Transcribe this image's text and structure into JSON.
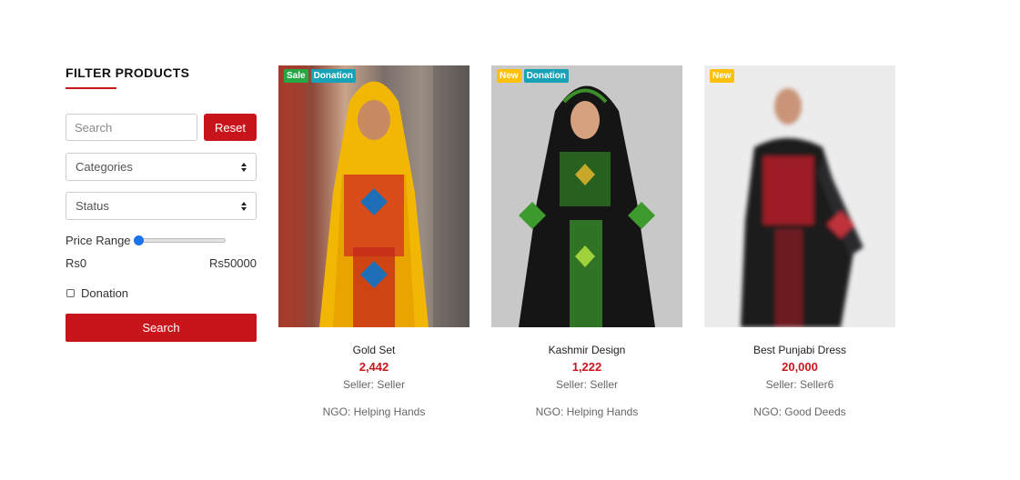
{
  "sidebar": {
    "title": "FILTER PRODUCTS",
    "search_placeholder": "Search",
    "reset_label": "Reset",
    "categories_label": "Categories",
    "status_label": "Status",
    "price_range_label": "Price Range",
    "price_min": "Rs0",
    "price_max": "Rs50000",
    "price_slider_value": 0,
    "donation_label": "Donation",
    "search_button_label": "Search"
  },
  "products": [
    {
      "badges": [
        "Sale",
        "Donation"
      ],
      "name": "Gold Set",
      "price": "2,442",
      "seller": "Seller: Seller",
      "ngo": "NGO: Helping Hands"
    },
    {
      "badges": [
        "New",
        "Donation"
      ],
      "name": "Kashmir Design",
      "price": "1,222",
      "seller": "Seller: Seller",
      "ngo": "NGO: Helping Hands"
    },
    {
      "badges": [
        "New"
      ],
      "name": "Best Punjabi Dress",
      "price": "20,000",
      "seller": "Seller: Seller6",
      "ngo": "NGO: Good Deeds"
    }
  ],
  "colors": {
    "accent_red": "#c8151b",
    "badge_sale": "#28a745",
    "badge_donation": "#17a2b8",
    "badge_new": "#ffc107",
    "slider_thumb": "#1a73e8"
  }
}
